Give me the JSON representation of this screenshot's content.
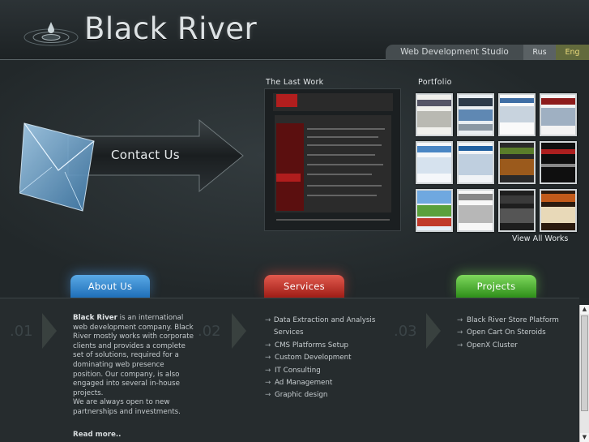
{
  "header": {
    "logo_text": "Black River",
    "studio_label": "Web Development Studio",
    "lang_rus": "Rus",
    "lang_eng": "Eng"
  },
  "hero": {
    "contact_label": "Contact Us",
    "last_work_title": "The Last Work",
    "portfolio_title": "Portfolio",
    "view_all": "View All Works"
  },
  "tabs": {
    "about": "About Us",
    "services": "Services",
    "projects": "Projects"
  },
  "sections": {
    "num1": ".01",
    "num2": ".02",
    "num3": ".03"
  },
  "about": {
    "brand": "Black River",
    "text1": " is an international web development company. Black River mostly works with corporate clients and provides a complete set of solutions, required for a dominating web presence position. Our company, is also engaged into several in-house projects.",
    "text2": "We are always open to new partnerships and investments.",
    "read_more": "Read more.."
  },
  "services": [
    "Data Extraction and Analysis Services",
    "CMS Platforms Setup",
    "Custom Development",
    "IT Consulting",
    "Ad Management",
    "Graphic design"
  ],
  "projects": [
    "Black River Store Platform",
    "Open Cart On Steroids",
    "OpenX Cluster"
  ],
  "colors": {
    "about_tab": "#1f6fb8",
    "services_tab": "#9f1d16",
    "projects_tab": "#2e8e19",
    "eng_lang": "#e8d87a"
  }
}
